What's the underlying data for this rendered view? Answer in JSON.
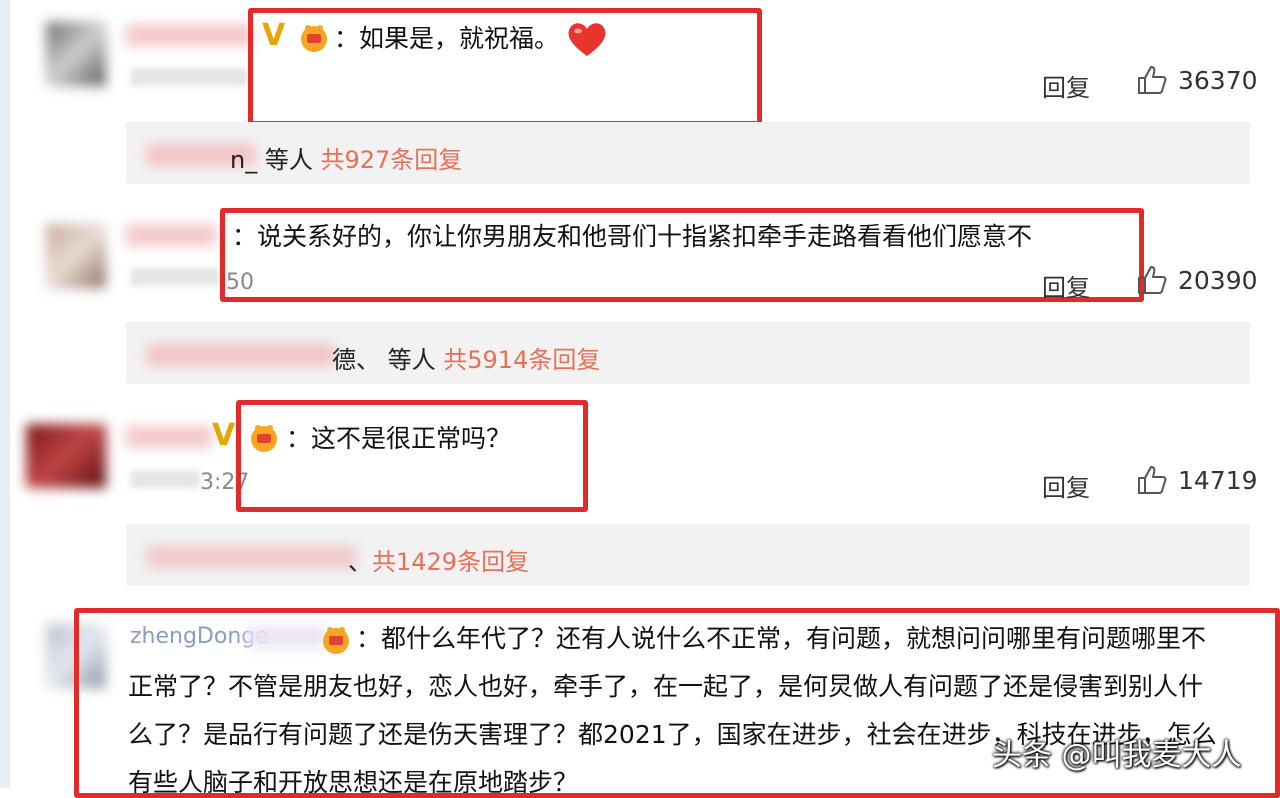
{
  "comments": [
    {
      "text": "：如果是，就祝福。",
      "time_suffix": "",
      "likes": "36370",
      "reply_label": "回复",
      "sub_name_suffix": "n_",
      "sub_mid": " 等人 ",
      "sub_count": "共927条回复"
    },
    {
      "text": "：说关系好的，你让你男朋友和他哥们十指紧扣牵手走路看看他们愿意不",
      "time_suffix": "50",
      "likes": "20390",
      "reply_label": "回复",
      "sub_name_suffix": "德、",
      "sub_mid": " 等人 ",
      "sub_count": "共5914条回复"
    },
    {
      "text": "：这不是很正常吗？",
      "time_suffix": "3:27",
      "likes": "14719",
      "reply_label": "回复",
      "sub_name_suffix": "、",
      "sub_mid": "",
      "sub_count": "共1429条回复"
    },
    {
      "username_partial": "zhengDonge",
      "line1": "：都什么年代了？还有人说什么不正常，有问题，就想问问哪里有问题哪里不",
      "line2": "正常了？不管是朋友也好，恋人也好，牵手了，在一起了，是何炅做人有问题了还是侵害到别人什",
      "line3": "么了？是品行有问题了还是伤天害理了？都2021了，国家在进步，社会在进步，科技在进步，怎么",
      "line4": "有些人脑子和开放思想还是在原地踏步？"
    }
  ],
  "badges": {
    "v": "V"
  },
  "watermark": "头条 @叫我麦大人",
  "colors": {
    "highlight_box": "#e32a2a",
    "reply_count": "#e96f56",
    "sub_bg": "#f2f2f2"
  },
  "icons": [
    "heart-emoji-icon",
    "thumbs-up-icon",
    "v-badge-icon",
    "fan-badge-icon"
  ]
}
